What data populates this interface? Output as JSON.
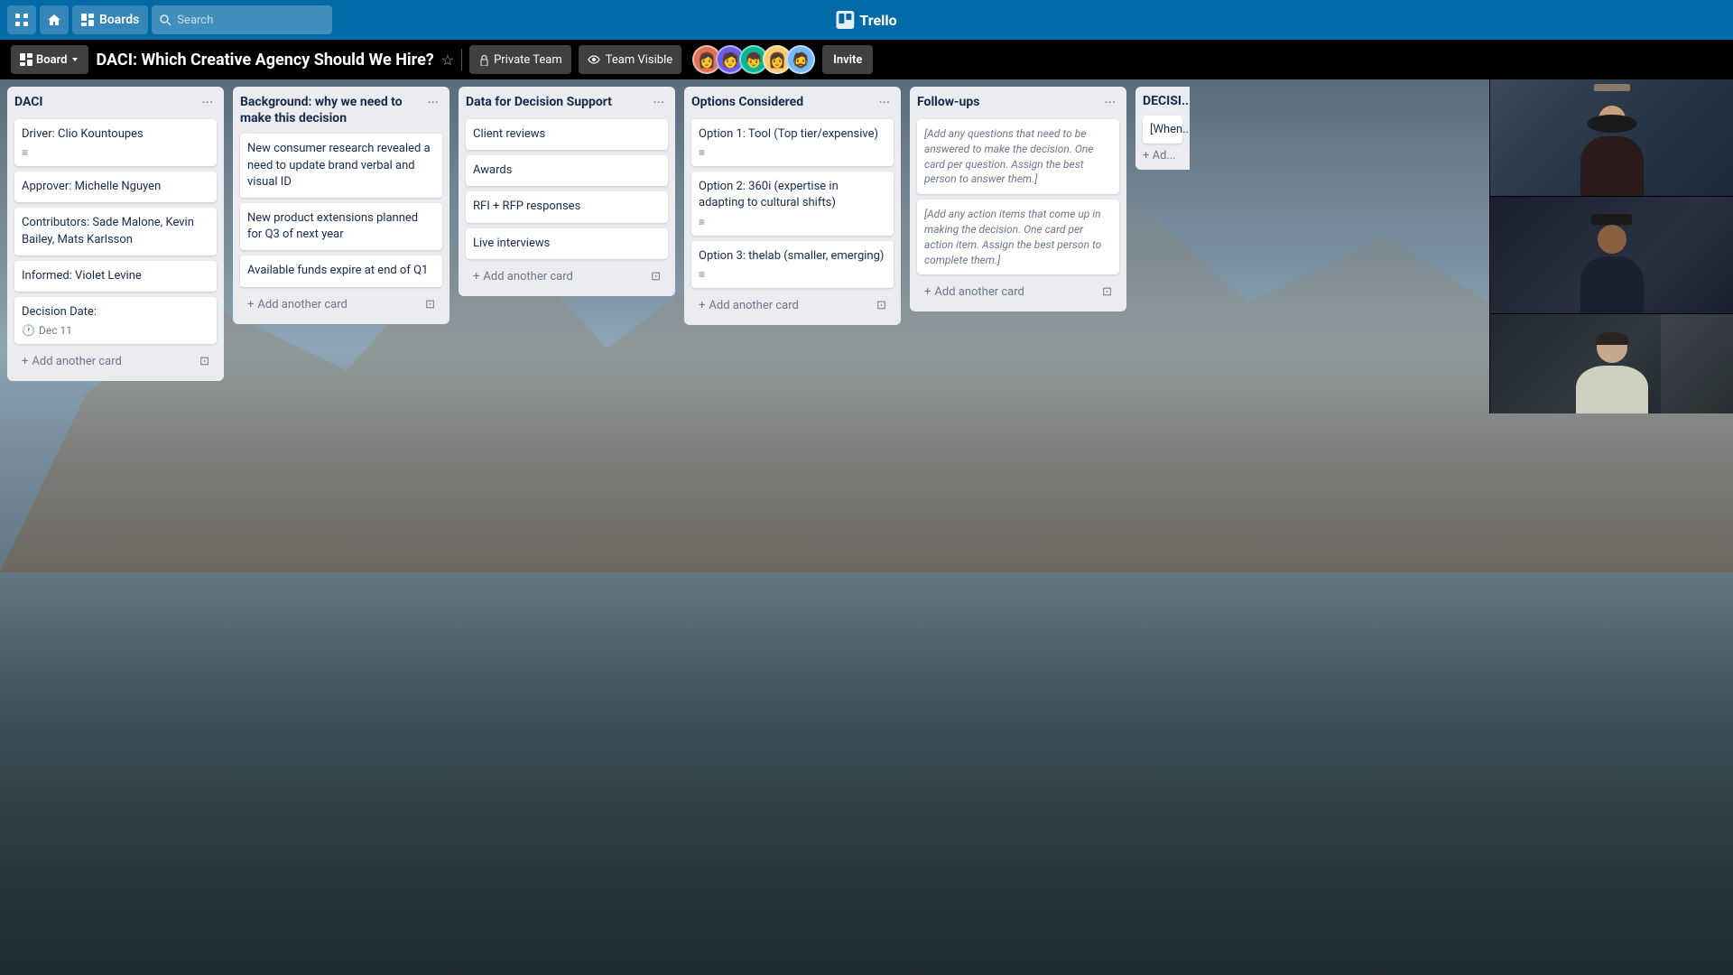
{
  "nav": {
    "apps_label": "⊞",
    "home_label": "🏠",
    "boards_label": "Boards",
    "search_placeholder": "Search",
    "trello_label": "Trello"
  },
  "board_header": {
    "board_btn": "Board",
    "title": "DACI: Which Creative Agency Should We Hire?",
    "private_team": "Private Team",
    "team_visible": "Team Visible",
    "invite": "Invite",
    "avatars": [
      "🧑",
      "👩",
      "👦",
      "👩‍🦱",
      "🧔"
    ]
  },
  "lists": [
    {
      "id": "daci",
      "title": "DACI",
      "cards": [
        {
          "text": "Driver: Clio Kountoupes",
          "has_desc": true
        },
        {
          "text": "Approver: Michelle Nguyen",
          "has_desc": false
        },
        {
          "text": "Contributors: Sade Malone, Kevin Bailey, Mats Karlsson",
          "has_desc": false
        },
        {
          "text": "Informed: Violet Levine",
          "has_desc": false
        },
        {
          "text": "Decision Date:",
          "has_desc": false,
          "date": "Dec 11"
        }
      ],
      "add_card": "Add another card"
    },
    {
      "id": "background",
      "title": "Background: why we need to make this decision",
      "cards": [
        {
          "text": "New consumer research revealed a need to update brand verbal and visual ID",
          "has_desc": false
        },
        {
          "text": "New product extensions planned for Q3 of next year",
          "has_desc": false
        },
        {
          "text": "Available funds expire at end of Q1",
          "has_desc": false
        }
      ],
      "add_card": "Add another card"
    },
    {
      "id": "data",
      "title": "Data for Decision Support",
      "cards": [
        {
          "text": "Client reviews",
          "has_desc": false
        },
        {
          "text": "Awards",
          "has_desc": false
        },
        {
          "text": "RFI + RFP responses",
          "has_desc": false
        },
        {
          "text": "Live interviews",
          "has_desc": false
        }
      ],
      "add_card": "Add another card"
    },
    {
      "id": "options",
      "title": "Options Considered",
      "cards": [
        {
          "text": "Option 1: Tool (Top tier/expensive)",
          "has_desc": true
        },
        {
          "text": "Option 2: 360i (expertise in adapting to cultural shifts)",
          "has_desc": true
        },
        {
          "text": "Option 3: thelab (smaller, emerging)",
          "has_desc": true
        }
      ],
      "add_card": "Add another card"
    },
    {
      "id": "followups",
      "title": "Follow-ups",
      "cards": [
        {
          "text": "[Add any questions that need to be answered to make the decision. One card per question. Assign the best person to answer them.]",
          "has_desc": false
        },
        {
          "text": "[Add any action items that come up in making the decision. One card per action item. Assign the best person to complete them.]",
          "has_desc": false
        }
      ],
      "add_card": "Add another card"
    },
    {
      "id": "decision",
      "title": "DECISI...",
      "partial": true,
      "cards": [
        {
          "text": "[When decision made, put it here.]",
          "has_desc": false
        }
      ],
      "add_card": "+ Ad..."
    }
  ]
}
